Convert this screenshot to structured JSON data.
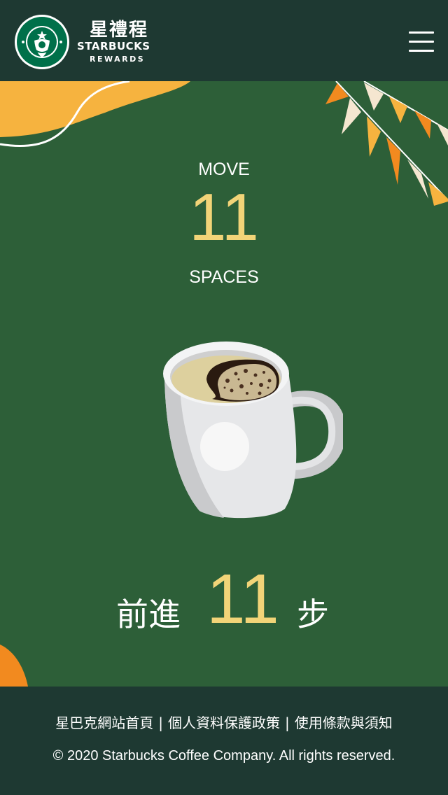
{
  "header": {
    "brand_cn": "星禮程",
    "brand_en": "STARBUCKS",
    "brand_sub": "REWARDS"
  },
  "main": {
    "move_label": "MOVE",
    "spaces_count": "11",
    "spaces_label": "SPACES",
    "cn_prefix": "前進",
    "cn_count": "11",
    "cn_suffix": "步"
  },
  "footer": {
    "links": [
      "星巴克網站首頁",
      "個人資料保護政策",
      "使用條款與須知"
    ],
    "copyright": "© 2020 Starbucks Coffee Company. All rights reserved."
  },
  "icons": [
    "starbucks-siren-logo-icon",
    "hamburger-menu-icon",
    "coffee-mug-icon",
    "bunting-flags-icon"
  ],
  "colors": {
    "header_bg": "#1e3932",
    "stage_bg": "#2d5f38",
    "accent_gold": "#f2d478",
    "accent_orange": "#f28a1f"
  }
}
